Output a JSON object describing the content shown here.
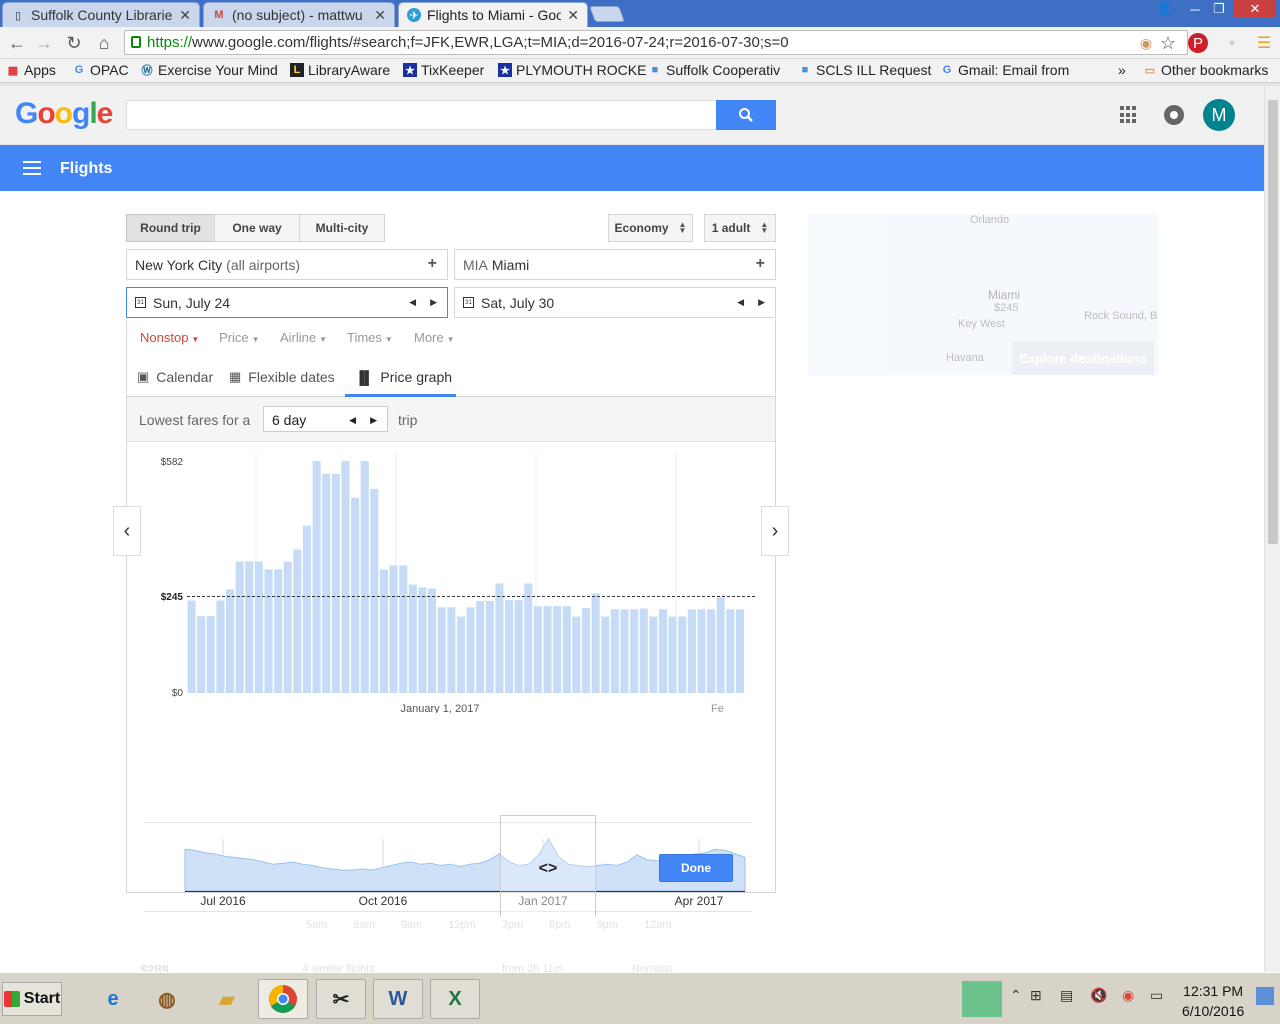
{
  "browser": {
    "tabs": [
      {
        "label": "Suffolk County Librarie",
        "icon": "doc-icon"
      },
      {
        "label": "(no subject) - mattwu",
        "icon": "gmail-icon"
      },
      {
        "label": "Flights to Miami - Goo",
        "icon": "flights-icon",
        "active": true
      }
    ],
    "url_scheme": "https://",
    "url_rest": "www.google.com/flights/#search;f=JFK,EWR,LGA;t=MIA;d=2016-07-24;r=2016-07-30;s=0",
    "bookmarks": [
      "Apps",
      "OPAC",
      "Exercise Your Mind",
      "LibraryAware",
      "TixKeeper",
      "PLYMOUTH ROCKE",
      "Suffolk Cooperativ",
      "SCLS ILL Request",
      "Gmail: Email from"
    ],
    "bookmarks_overflow": "»",
    "other_bookmarks": "Other bookmarks"
  },
  "google": {
    "logo": "Google",
    "avatar_letter": "M"
  },
  "header": {
    "title": "Flights"
  },
  "trip_types": [
    "Round trip",
    "One way",
    "Multi-city"
  ],
  "cabin": "Economy",
  "passengers": "1 adult",
  "origin": {
    "city": "New York City",
    "suffix": "(all airports)"
  },
  "destination": {
    "code": "MIA",
    "city": "Miami"
  },
  "depart_date": "Sun, July 24",
  "return_date": "Sat, July 30",
  "calendar_glyph": "31",
  "filters": [
    "Nonstop",
    "Price",
    "Airline",
    "Times",
    "More"
  ],
  "views": [
    "Calendar",
    "Flexible dates",
    "Price graph"
  ],
  "fares": {
    "prefix": "Lowest fares for a",
    "duration": "6 day",
    "suffix": "trip"
  },
  "done_label": "Done",
  "map": {
    "city1": "Orlando",
    "city2": "Miami",
    "price": "$245",
    "city3": "Key West",
    "city4": "Havana",
    "city5": "Rock Sound, Bahamas",
    "explore": "Explore destinations"
  },
  "ghost": {
    "times": [
      "5am",
      "6am",
      "9am",
      "12pm",
      "3pm",
      "6pm",
      "9pm",
      "12am"
    ],
    "price": "$289",
    "similar": "4 similar flights",
    "duration": "from 3h 11m",
    "stops": "Nonstop"
  },
  "chart_data": {
    "type": "bar",
    "ytick_labels": [
      "$582",
      "$245",
      "$0"
    ],
    "ymax": 582,
    "reference_line": 245,
    "xtick_labels": [
      "January 1, 2017",
      "Fe"
    ],
    "values": [
      232,
      193,
      193,
      232,
      260,
      330,
      330,
      330,
      310,
      310,
      330,
      360,
      420,
      590,
      550,
      550,
      590,
      490,
      590,
      512,
      310,
      320,
      320,
      272,
      265,
      262,
      215,
      215,
      192,
      215,
      231,
      231,
      275,
      233,
      233,
      275,
      218,
      218,
      218,
      218,
      192,
      213,
      250,
      192,
      210,
      210,
      210,
      212,
      192,
      210,
      192,
      192,
      210,
      210,
      210,
      240,
      210,
      210
    ]
  },
  "overview": {
    "labels": [
      "Jul 2016",
      "Oct 2016",
      "Jan 2017",
      "Apr 2017"
    ],
    "values": [
      0.72,
      0.7,
      0.66,
      0.64,
      0.6,
      0.58,
      0.56,
      0.54,
      0.5,
      0.46,
      0.48,
      0.5,
      0.46,
      0.44,
      0.4,
      0.38,
      0.36,
      0.36,
      0.38,
      0.36,
      0.4,
      0.44,
      0.48,
      0.5,
      0.46,
      0.48,
      0.44,
      0.46,
      0.42,
      0.46,
      0.48,
      0.54,
      0.64,
      0.5,
      0.44,
      0.46,
      0.62,
      0.9,
      0.6,
      0.46,
      0.44,
      0.42,
      0.44,
      0.46,
      0.44,
      0.5,
      0.62,
      0.54,
      0.52,
      0.56,
      0.6,
      0.62,
      0.64,
      0.66,
      0.72,
      0.7,
      0.64,
      0.58
    ]
  },
  "taskbar": {
    "start": "Start",
    "time": "12:31 PM",
    "date": "6/10/2016"
  }
}
